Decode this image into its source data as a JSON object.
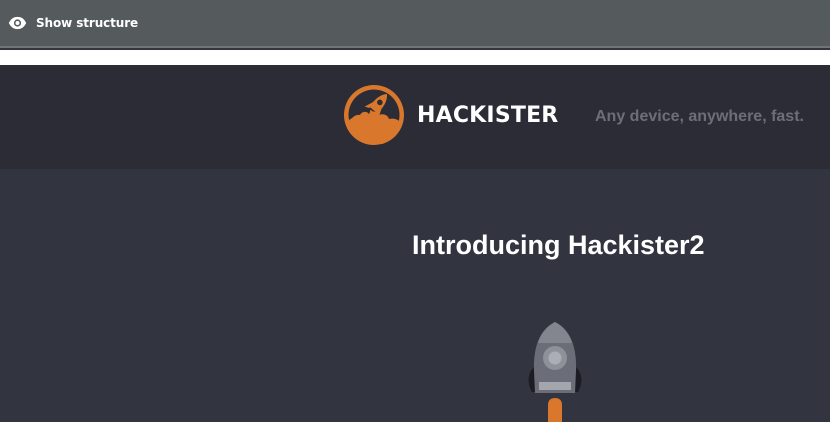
{
  "toolbar": {
    "show_structure_label": "Show structure",
    "icon": "eye-icon"
  },
  "header": {
    "brand": "HACKISTER",
    "tagline": "Any device, anywhere, fast.",
    "logo_icon": "rocket-logo-icon"
  },
  "hero": {
    "title": "Introducing Hackister2",
    "illustration": "rocket-illustration"
  },
  "colors": {
    "toolbar_bg": "#555a5d",
    "header_bg": "#2c2c36",
    "page_bg": "#323440",
    "accent_orange": "#d9782d",
    "tagline_text": "#6e6e78"
  }
}
